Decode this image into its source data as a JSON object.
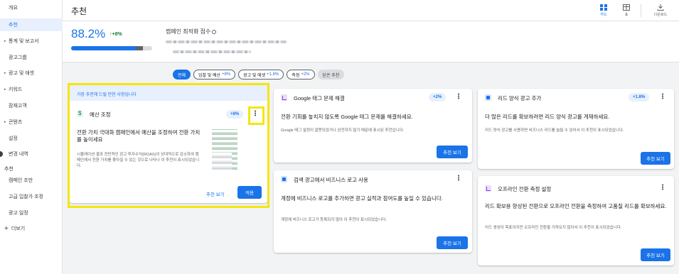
{
  "sidebar": {
    "items": [
      {
        "label": "개요",
        "caret": false
      },
      {
        "label": "추천",
        "caret": false,
        "active": true
      },
      {
        "label": "통계 및 보고서",
        "caret": true
      },
      {
        "label": "광고그룹",
        "caret": false
      },
      {
        "label": "광고 및 애셋",
        "caret": true
      },
      {
        "label": "키워드",
        "caret": true
      },
      {
        "label": "잠재고객",
        "caret": false
      },
      {
        "label": "콘텐츠",
        "caret": true
      },
      {
        "label": "설정",
        "caret": false
      },
      {
        "label": "변경 내역",
        "caret": false
      },
      {
        "label": "추천",
        "caret": false,
        "section": true
      },
      {
        "label": "캠페인 조만",
        "caret": false
      },
      {
        "label": "고급 입찰가 조정",
        "caret": false
      },
      {
        "label": "광고 일정",
        "caret": false
      },
      {
        "label": "더보기",
        "caret": false,
        "plus": true
      }
    ]
  },
  "header": {
    "title": "추천",
    "views": [
      {
        "label": "카드",
        "icon": "card-view-icon",
        "active": true
      },
      {
        "label": "표",
        "icon": "table-view-icon"
      },
      {
        "label": "다운로드",
        "icon": "download-icon"
      }
    ]
  },
  "score": {
    "value": "88.2%",
    "delta": "+8%",
    "fill_percent": 80.2,
    "gain_percent": 8,
    "label": "캠페인 최적화 점수"
  },
  "filters": [
    {
      "label": "전체",
      "active": true
    },
    {
      "label": "입찰 및 예산",
      "delta": "+8%"
    },
    {
      "label": "광고 및 애셋",
      "delta": "+1.8%"
    },
    {
      "label": "측정",
      "delta": "+2%"
    },
    {
      "label": "닫은 추천",
      "muted": true
    }
  ],
  "cards": {
    "budget": {
      "tip": "가장 추천해 드릴 만한 사항입니다",
      "title": "예산 조정",
      "badge": "+8%",
      "headline": "전환 가치 극대화 캠페인에서 예산을 조정하여 전환 가치를 높이세요",
      "desc": "시뮬레이션 결과 전반적인 광고 투자수익(ROAS)이 상대적으로 감소하여 캠페인에서 전환 가치를 좋아질 수 있는 것으로 나타나 이 추천이 표시되었습니다.",
      "view": "추천 보기",
      "apply": "적용"
    },
    "tag": {
      "title": "Google 태그 문제 해결",
      "badge": "+2%",
      "headline": "전환 기회를 놓치지 않도록 Google 태그 문제를 해결하세요.",
      "desc": "Google 태그 설정이 잘못되었거나 완전하지 않기 때문에 표시된 추천입니다.",
      "button": "추천 보기"
    },
    "lead_form": {
      "title": "리드 양식 광고 추가",
      "badge": "+1.8%",
      "headline": "더 많은 리드를 확보하려면 리드 양식 광고를 게재하세요.",
      "desc": "리드 양식 광고를 사용하면 비즈니스 리드를 늘릴 수 있어서 이 추천이 표시되었습니다.",
      "button": "추천 보기"
    },
    "logo": {
      "title": "검색 광고에서 비즈니스 로고 사용",
      "headline": "계정에 비즈니스 로고를 추가하면 광고 실적과 참여도를 높일 수 있습니다.",
      "desc": "계정에 비즈니스 로고가 등록되지 않아 이 추천이 표시되었습니다.",
      "button": "추천 보기"
    },
    "offline": {
      "title": "오프라인 전환 측정 설정",
      "headline": "리드 확보용 향상된 전환으로 오프라인 전환을 측정하여 고품질 리드를 확보하세요.",
      "desc": "리드 생성이 목표이지만 오프라인 전환을 가져오지 않아서 이 추천이 표시되었습니다.",
      "button": "추천 보기"
    }
  },
  "colors": {
    "accent": "#1a73e8",
    "positive": "#188038",
    "highlight": "#f4e60c"
  }
}
